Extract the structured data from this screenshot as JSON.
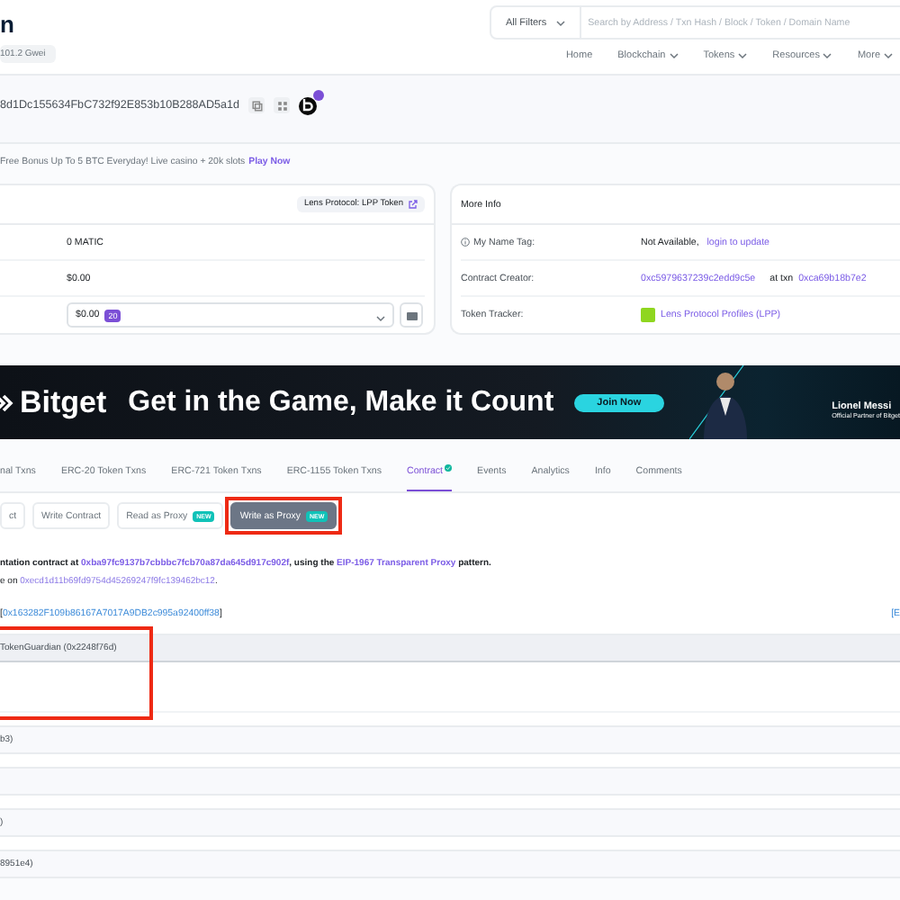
{
  "header": {
    "brand": "n",
    "gas": "101.2 Gwei",
    "filter": "All Filters",
    "placeholder": "Search by Address / Txn Hash / Block / Token / Domain Name",
    "nav": [
      {
        "label": "Home",
        "dropdown": false
      },
      {
        "label": "Blockchain",
        "dropdown": true
      },
      {
        "label": "Tokens",
        "dropdown": true
      },
      {
        "label": "Resources",
        "dropdown": true
      },
      {
        "label": "More",
        "dropdown": true
      }
    ]
  },
  "address": "8d1Dc155634FbC732f92E853b10B288AD5a1d",
  "promo": {
    "text": "Free Bonus Up To 5 BTC Everyday! Live casino + 20k slots",
    "link": "Play Now"
  },
  "overview": {
    "tag": "Lens Protocol: LPP Token",
    "balance": "0 MATIC",
    "value": "$0.00",
    "holdings": "$0.00",
    "holdings_count": "20"
  },
  "more_info": {
    "title": "More Info",
    "name_tag": {
      "label": "My Name Tag:",
      "value": "Not Available,",
      "link": "login to update"
    },
    "creator": {
      "label": "Contract Creator:",
      "address": "0xc5979637239c2edd9c5e",
      "at": "at txn",
      "txn": "0xca69b18b7e2"
    },
    "tracker": {
      "label": "Token Tracker:",
      "token": "Lens Protocol Profiles (LPP)"
    }
  },
  "banner": {
    "logo": "Bitget",
    "headline": "Get in the Game, Make it Count",
    "button": "Join Now",
    "name": "Lionel Messi",
    "caption": "Official Partner of Bitget"
  },
  "tabs": [
    {
      "label": "nal Txns",
      "selected": false,
      "verified": false
    },
    {
      "label": "ERC-20 Token Txns",
      "selected": false,
      "verified": false
    },
    {
      "label": "ERC-721 Token Txns",
      "selected": false,
      "verified": false
    },
    {
      "label": "ERC-1155 Token Txns",
      "selected": false,
      "verified": false
    },
    {
      "label": "Contract",
      "selected": true,
      "verified": true
    },
    {
      "label": "Events",
      "selected": false,
      "verified": false
    },
    {
      "label": "Analytics",
      "selected": false,
      "verified": false
    },
    {
      "label": "Info",
      "selected": false,
      "verified": false
    },
    {
      "label": "Comments",
      "selected": false,
      "verified": false
    }
  ],
  "sub_tabs": [
    {
      "label": "ct",
      "selected": false,
      "highlighted": false
    },
    {
      "label": "Write Contract",
      "selected": false,
      "highlighted": false
    },
    {
      "label": "Read as Proxy",
      "badge": "NEW",
      "selected": false,
      "highlighted": false
    },
    {
      "label": "Write as Proxy",
      "badge": "NEW",
      "selected": true,
      "highlighted": true
    }
  ],
  "proxy_note": [
    [
      {
        "text": "ntation contract at ",
        "kind": "text"
      },
      {
        "text": "0xba97fc9137b7cbbbc7fcb70a87da645d917c902f",
        "kind": "link"
      },
      {
        "text": ", using the ",
        "kind": "text"
      },
      {
        "text": "EIP-1967 Transparent Proxy",
        "kind": "link"
      },
      {
        "text": " pattern.",
        "kind": "text"
      }
    ],
    [
      {
        "text": "e on ",
        "kind": "text"
      },
      {
        "text": "0xecd1d11b69fd9754d45269247f9fc139462bc12",
        "kind": "link"
      },
      {
        "text": ".",
        "kind": "text"
      }
    ]
  ],
  "implementation": {
    "open": "[",
    "address": "0x163282F109b86167A7017A9DB2c995a92400ff38",
    "close": "]",
    "right": "[E"
  },
  "functions": [
    {
      "label": "TokenGuardian (0x2248f76d)",
      "expanded": true,
      "highlighted": true
    },
    {
      "label": "b3)",
      "expanded": false,
      "highlighted": false
    },
    {
      "expanded": false,
      "highlighted": false
    },
    {
      "label": ")",
      "expanded": false,
      "highlighted": false
    },
    {
      "label": "8951e4)",
      "expanded": false,
      "highlighted": false
    }
  ]
}
